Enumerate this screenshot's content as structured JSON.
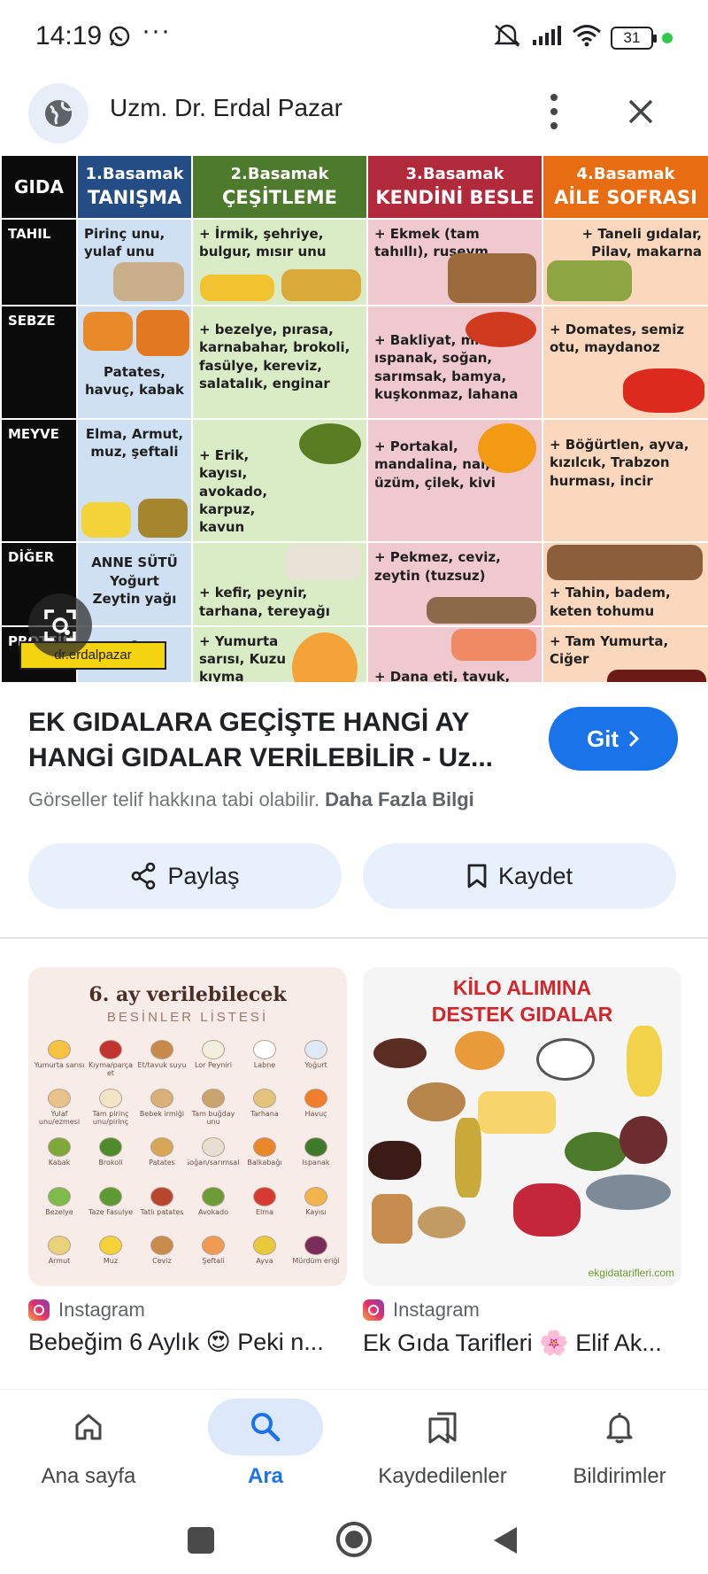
{
  "status_bar": {
    "time": "14:19",
    "more": "···",
    "battery": "31"
  },
  "header": {
    "site_name": "Uzm. Dr. Erdal Pazar"
  },
  "food_table": {
    "col_gida": "GIDA",
    "headers": [
      {
        "step": "1.Basamak",
        "name": "TANIŞMA"
      },
      {
        "step": "2.Basamak",
        "name": "ÇEŞİTLEME"
      },
      {
        "step": "3.Basamak",
        "name": "KENDİNİ BESLE"
      },
      {
        "step": "4.Basamak",
        "name": "AİLE SOFRASI"
      }
    ],
    "rows": [
      {
        "label": "TAHIL",
        "cells": [
          "Pirinç unu, yulaf unu",
          "+ İrmik, şehriye, bulgur, mısır unu",
          "+ Ekmek (tam tahıllı), ruşeym",
          "+ Taneli gıdalar, Pilav, makarna"
        ]
      },
      {
        "label": "SEBZE",
        "cells": [
          "Patates, havuç, kabak",
          "+ bezelye, pırasa, karnabahar, brokoli, fasülye, kereviz, salatalık, enginar",
          "+ Bakliyat, mısır, ıspanak, soğan, sarımsak, bamya, kuşkonmaz, lahana",
          "+ Domates, semiz otu, maydanoz"
        ]
      },
      {
        "label": "MEYVE",
        "cells": [
          "Elma, Armut, muz, şeftali",
          "+ Erik, kayısı, avokado, karpuz, kavun",
          "+ Portakal, mandalina, nar, üzüm, çilek, kivi",
          "+ Böğürtlen, ayva, kızılcık, Trabzon hurması, incir"
        ]
      },
      {
        "label": "DİĞER",
        "cells": [
          "ANNE SÜTÜ Yoğurt Zeytin yağı",
          "+ kefir, peynir, tarhana, tereyağı",
          "+ Pekmez, ceviz, zeytin (tuzsuz)",
          "+ Tahin, badem, keten tohumu"
        ]
      },
      {
        "label": "PROTEİN",
        "cells": [
          "-",
          "+ Yumurta sarısı, Kuzu kıyma",
          "+ Dana eti, tavuk, balık, hindi",
          "+ Tam Yumurta, Ciğer"
        ]
      }
    ],
    "watermark": "dr.erdalpazar"
  },
  "result": {
    "title": "EK GIDALARA GEÇİŞTE HANGİ AY HANGİ GIDALAR VERİLEBİLİR - Uz...",
    "visit_label": "Git",
    "copyright_text": "Görseller telif hakkına tabi olabilir.",
    "more_info": "Daha Fazla Bilgi",
    "share_label": "Paylaş",
    "save_label": "Kaydet"
  },
  "related": [
    {
      "image_title": "6. ay verilebilecek",
      "image_subtitle": "BESİNLER LİSTESİ",
      "image_items": [
        "Yumurta sarısı",
        "Kıyma/parça et",
        "Et/tavuk suyu",
        "Lor Peyniri",
        "Labne",
        "Yoğurt",
        "Yulaf unu/ezmesi",
        "Tam pirinç unu/pirinç",
        "Bebek irmiği",
        "Tam buğday unu",
        "Tarhana",
        "Havuç",
        "Kabak",
        "Brokoli",
        "Patates",
        "Soğan/sarımsak",
        "Balkabağı",
        "Ispanak",
        "Bezelye",
        "Taze Fasulye",
        "Tatlı patates",
        "Avokado",
        "Elma",
        "Kayısı",
        "Armut",
        "Muz",
        "Ceviz",
        "Şeftali",
        "Ayva",
        "Mürdüm eriği"
      ],
      "source": "Instagram",
      "caption": "Bebeğim 6 Aylık 😍 Peki n..."
    },
    {
      "image_title": "KİLO ALIMINA DESTEK GIDALAR",
      "image_watermark": "ekgidatarifleri.com",
      "source": "Instagram",
      "caption": "Ek Gıda Tarifleri 🌸 Elif Ak..."
    }
  ],
  "bottom_nav": [
    {
      "label": "Ana sayfa",
      "icon": "home-icon",
      "active": false
    },
    {
      "label": "Ara",
      "icon": "search-icon",
      "active": true
    },
    {
      "label": "Kaydedilenler",
      "icon": "saved-icon",
      "active": false
    },
    {
      "label": "Bildirimler",
      "icon": "bell-icon",
      "active": false
    }
  ],
  "colors": {
    "accent": "#1a73e8",
    "pill_bg": "#e8f0fb",
    "step1": "#244c85",
    "step2": "#4d7a2c",
    "step3": "#b12a3b",
    "step4": "#e86d12"
  }
}
